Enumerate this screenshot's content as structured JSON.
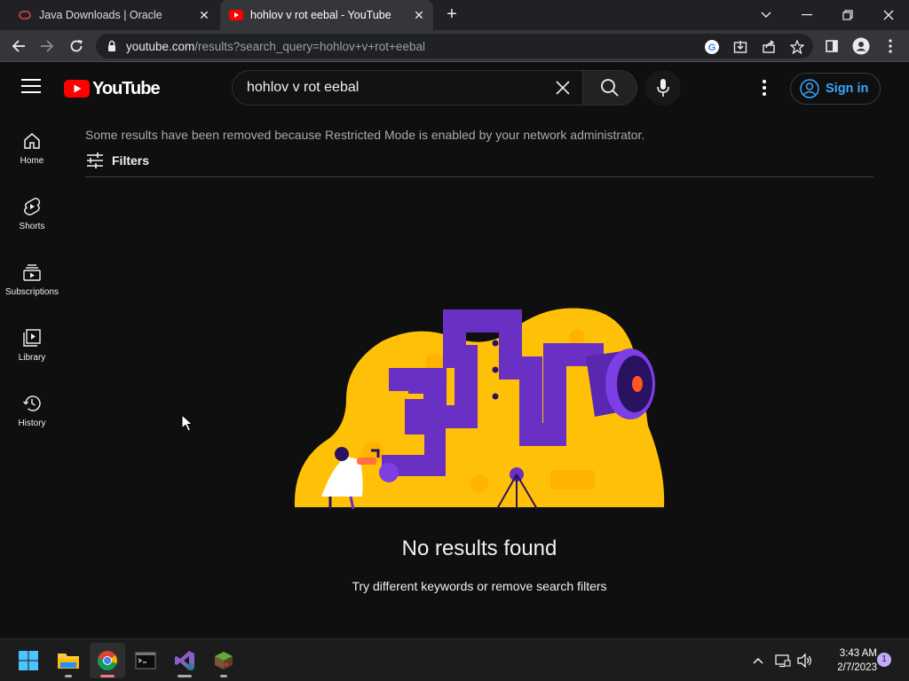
{
  "browser": {
    "tabs": [
      {
        "title": "Java Downloads | Oracle",
        "active": false
      },
      {
        "title": "hohlov v rot eebal - YouTube",
        "active": true
      }
    ],
    "url_host": "youtube.com",
    "url_path": "/results?search_query=hohlov+v+rot+eebal"
  },
  "youtube": {
    "logo_text": "YouTube",
    "search": {
      "value": "hohlov v rot eebal"
    },
    "signin_label": "Sign in",
    "nav": [
      {
        "label": "Home",
        "icon": "home-icon"
      },
      {
        "label": "Shorts",
        "icon": "shorts-icon"
      },
      {
        "label": "Subscriptions",
        "icon": "subscriptions-icon"
      },
      {
        "label": "Library",
        "icon": "library-icon"
      },
      {
        "label": "History",
        "icon": "history-icon"
      }
    ],
    "restricted_message": "Some results have been removed because Restricted Mode is enabled by your network administrator.",
    "filters_label": "Filters",
    "no_results_title": "No results found",
    "no_results_hint": "Try different keywords or remove search filters"
  },
  "taskbar": {
    "apps": [
      "start-icon",
      "file-explorer-icon",
      "chrome-icon",
      "terminal-icon",
      "visual-studio-icon",
      "minecraft-icon"
    ],
    "time": "3:43 AM",
    "date": "2/7/2023",
    "notification_count": "1"
  },
  "colors": {
    "yt_background": "#0f0f0f",
    "yt_red": "#ff0000",
    "link_blue": "#3ea6ff",
    "illustration_yellow": "#ffc107",
    "illustration_purple": "#6930c3"
  }
}
